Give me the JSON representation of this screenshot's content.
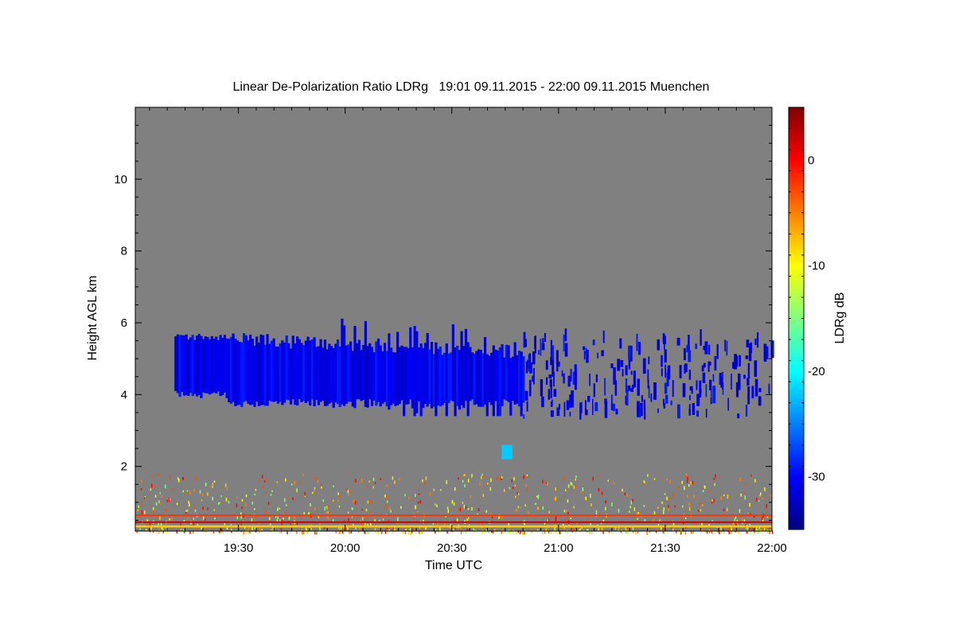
{
  "chart_data": {
    "type": "heatmap",
    "title": "Linear De-Polarization Ratio LDRg   19:01 09.11.2015 - 22:00 09.11.2015 Muenchen",
    "xlabel": "Time UTC",
    "ylabel": "Height AGL km",
    "xlim": [
      "19:01",
      "22:00"
    ],
    "xticks": [
      "19:30",
      "20:00",
      "20:30",
      "21:00",
      "21:30",
      "22:00"
    ],
    "ylim": [
      0.2,
      12
    ],
    "yticks": [
      2,
      4,
      6,
      8,
      10
    ],
    "colorbar": {
      "label": "LDRg dB",
      "range": [
        -35,
        5
      ],
      "ticks": [
        0,
        -10,
        -20,
        -30
      ],
      "colormap": "jet"
    },
    "background_color": "#808080",
    "features": [
      {
        "name": "main cloud layer",
        "t_start": "19:12",
        "t_end": "20:50",
        "h_bottom": 3.4,
        "h_top": 5.8,
        "ldr_db": -31
      },
      {
        "name": "scattered cloud fragments",
        "t_start": "20:50",
        "t_end": "22:00",
        "h_bottom": 3.3,
        "h_top": 5.5,
        "ldr_db": -31
      },
      {
        "name": "cyan patch",
        "t_start": "20:44",
        "t_end": "20:47",
        "h_bottom": 2.2,
        "h_top": 2.6,
        "ldr_db": -22
      },
      {
        "name": "boundary layer aerosol",
        "t_start": "19:01",
        "t_end": "22:00",
        "h_bottom": 0.2,
        "h_top": 1.8,
        "ldr_db": -8
      }
    ]
  }
}
